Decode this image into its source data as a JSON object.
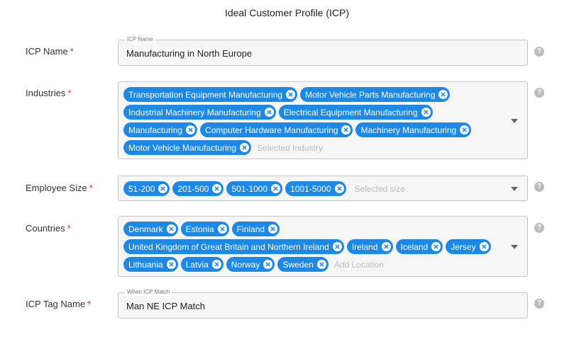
{
  "page": {
    "title": "Ideal Customer Profile (ICP)"
  },
  "required_mark": "*",
  "icp_name": {
    "label": "ICP Name",
    "floating_label": "ICP Name",
    "value": "Manufacturing in North Europe"
  },
  "industries": {
    "label": "Industries",
    "placeholder": "Selected Industry",
    "chips": [
      "Transportation Equipment Manufacturing",
      "Motor Vehicle Parts Manufacturing",
      "Industrial Machinery Manufacturing",
      "Electrical Equipment Manufacturing",
      "Manufacturing",
      "Computer Hardware Manufacturing",
      "Machinery Manufacturing",
      "Motor Vehicle Manufacturing"
    ]
  },
  "employee_size": {
    "label": "Employee Size",
    "placeholder": "Selected size",
    "chips": [
      "51-200",
      "201-500",
      "501-1000",
      "1001-5000"
    ]
  },
  "countries": {
    "label": "Countries",
    "placeholder": "Add Location",
    "chips": [
      "Denmark",
      "Estonia",
      "Finland",
      "United Kingdom of Great Britain and Northern Ireland",
      "Ireland",
      "Iceland",
      "Jersey",
      "Lithuania",
      "Latvia",
      "Norway",
      "Sweden"
    ]
  },
  "icp_tag_name": {
    "label": "ICP Tag Name",
    "floating_label": "When ICP Match",
    "value": "Man NE ICP Match"
  },
  "help_icon_glyph": "?",
  "colors": {
    "chip": "#1e88e5",
    "required": "#e0232a",
    "field_bg": "#f6f6f6"
  }
}
